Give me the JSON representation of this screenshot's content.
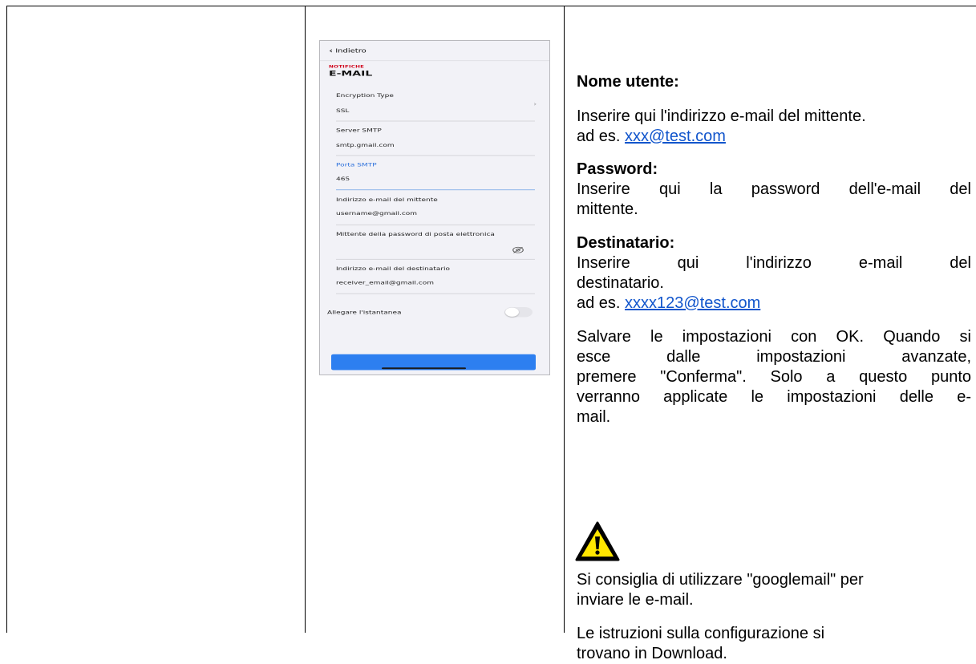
{
  "phone": {
    "back_label": "Indietro",
    "section_label": "NOTIFICHE",
    "page_title": "E-MAIL",
    "fields": [
      {
        "label": "Encryption Type",
        "value": "SSL"
      },
      {
        "label": "Server SMTP",
        "value": "smtp.gmail.com"
      },
      {
        "label": "Porta SMTP",
        "value": "465"
      },
      {
        "label": "Indirizzo e-mail del mittente",
        "value": "username@gmail.com"
      },
      {
        "label": "Mittente della password di posta elettronica",
        "value": ""
      },
      {
        "label": "Indirizzo e-mail del destinatario",
        "value": "receiver_email@gmail.com"
      }
    ],
    "snapshot_label": "Allegare l'istantanea",
    "snapshot_enabled": false,
    "accent_color": "#2d7ff0",
    "section_color": "#d0021b"
  },
  "description": {
    "username_heading": "Nome utente:",
    "username_text": "Inserire qui l'indirizzo e-mail del mittente.",
    "username_example_prefix": "ad es. ",
    "username_example": "xxx@test.com",
    "password_heading": "Password:",
    "password_text_line1": "Inserire qui la password dell'e-mail del",
    "password_text_line2": "mittente.",
    "recipient_heading": "Destinatario:",
    "recipient_text_line1": "Inserire qui l'indirizzo e-mail del",
    "recipient_text_line2": "destinatario.",
    "recipient_example_prefix": "ad es. ",
    "recipient_example": "xxxx123@test.com",
    "save_line1": "Salvare le impostazioni con OK. Quando si",
    "save_line2": "esce dalle impostazioni avanzate,",
    "save_line3": "premere \"Conferma\". Solo a questo punto",
    "save_line4": "verranno applicate le impostazioni delle e-",
    "save_line5": "mail.",
    "tip_line1": "Si consiglia di utilizzare \"googlemail\" per",
    "tip_line2": "inviare le e-mail.",
    "instructions_line1": "Le istruzioni sulla configurazione si",
    "instructions_line2": "trovano in Download."
  },
  "icons": {
    "back": "chevron-left-icon",
    "disclosure": "chevron-right-icon",
    "password_visibility": "eye-slash-icon",
    "warning": "warning-triangle-icon"
  }
}
